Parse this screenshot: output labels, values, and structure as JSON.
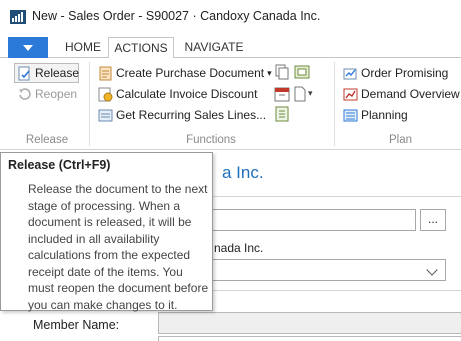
{
  "window": {
    "title": "New - Sales Order - S90027 · Candoxy Canada Inc."
  },
  "tabs": [
    {
      "label": "HOME"
    },
    {
      "label": "ACTIONS"
    },
    {
      "label": "NAVIGATE"
    }
  ],
  "active_tab": "ACTIONS",
  "ribbon": {
    "release_group": {
      "label": "Release",
      "release": "Release",
      "reopen": "Reopen"
    },
    "functions_group": {
      "label": "Functions",
      "create_purchase_document": "Create Purchase Document",
      "calculate_invoice_discount": "Calculate Invoice Discount",
      "get_recurring_sales_lines": "Get Recurring Sales Lines..."
    },
    "plan_group": {
      "label": "Plan",
      "order_promising": "Order Promising",
      "demand_overview": "Demand Overview",
      "planning": "Planning"
    }
  },
  "tooltip": {
    "title": "Release (Ctrl+F9)",
    "body": "Release the document to the next stage of processing. When a document is released, it will be included in all availability calculations from the expected receipt date of the items. You must reopen the document before you can make changes to it."
  },
  "form": {
    "heading_visible": "a Inc.",
    "ellipsis_label": "...",
    "customer_name_visible": "nada Inc.",
    "member_name_label": "Member Name:"
  },
  "colors": {
    "accent": "#2b79d8",
    "heading": "#1e6fbd"
  }
}
